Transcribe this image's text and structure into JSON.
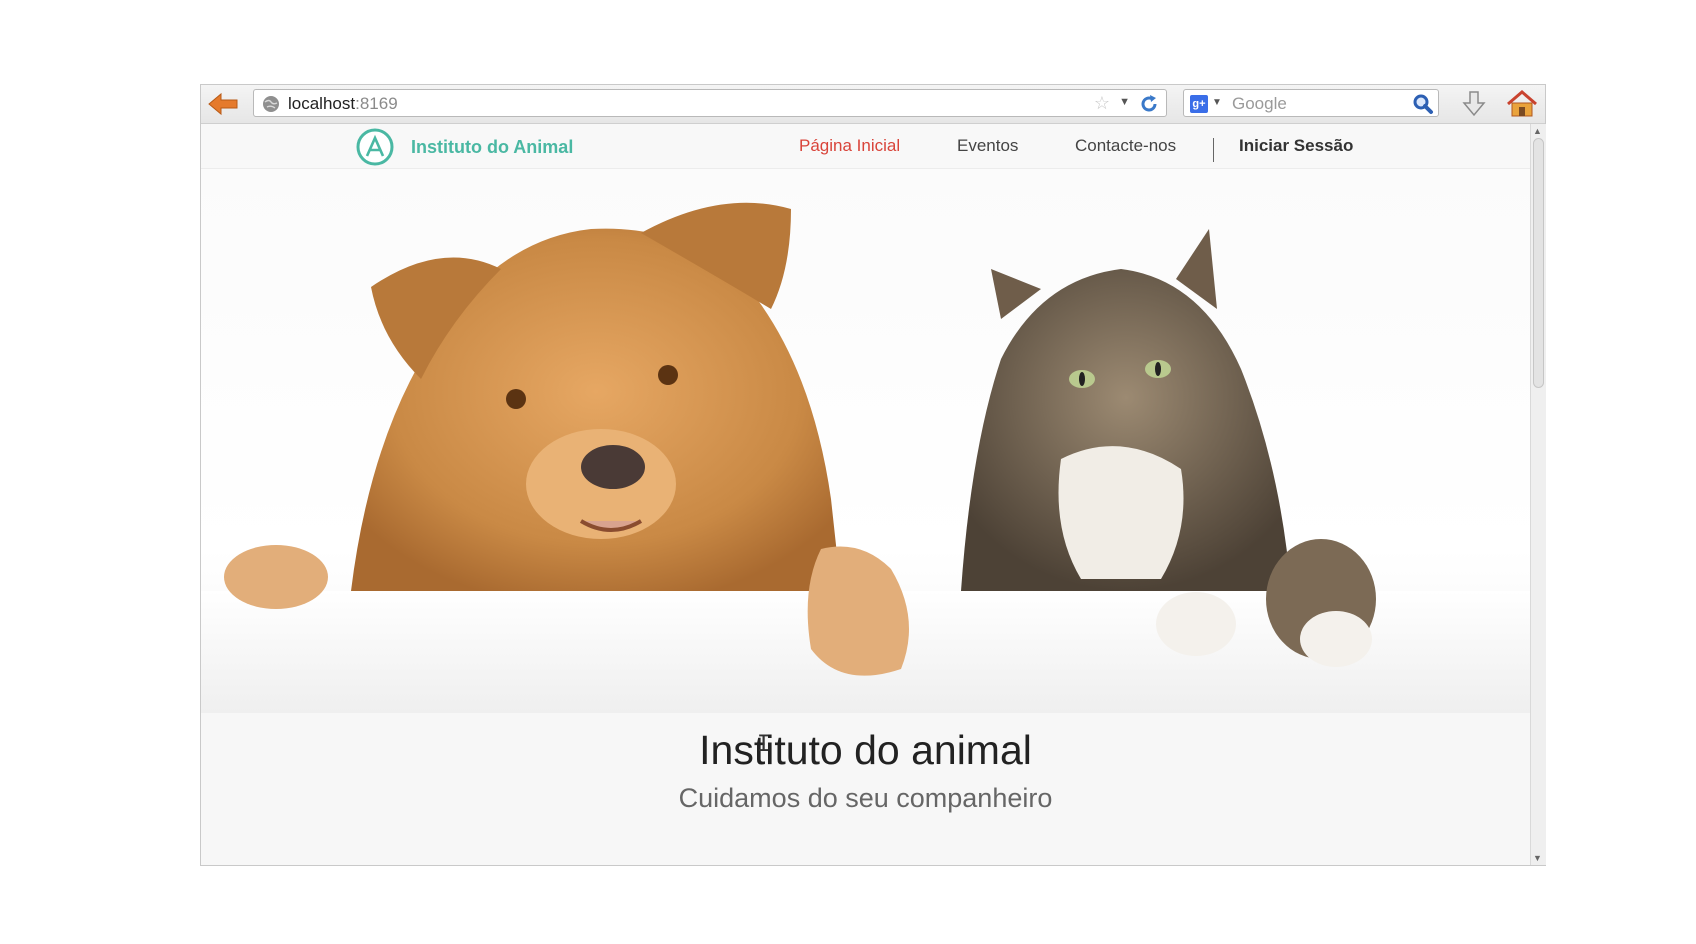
{
  "browser": {
    "url_host": "localhost",
    "url_port": ":8169",
    "search_engine_icon": "google-plus-icon",
    "search_placeholder": "Google",
    "icons": {
      "back": "back-arrow-icon",
      "site": "globe-icon",
      "bookmark": "star-icon",
      "reload": "reload-icon",
      "search": "magnifier-icon",
      "downloads": "download-arrow-icon",
      "home": "home-icon"
    }
  },
  "site": {
    "brand_name": "Instituto do Animal",
    "brand_color": "#4ab8a3",
    "nav": {
      "home": "Página Inicial",
      "events": "Eventos",
      "contact": "Contacte-nos",
      "login": "Iniciar Sessão"
    },
    "active_nav_color": "#d9443a"
  },
  "hero": {
    "title": "Instituto do animal",
    "subtitle": "Cuidamos do seu companheiro"
  }
}
